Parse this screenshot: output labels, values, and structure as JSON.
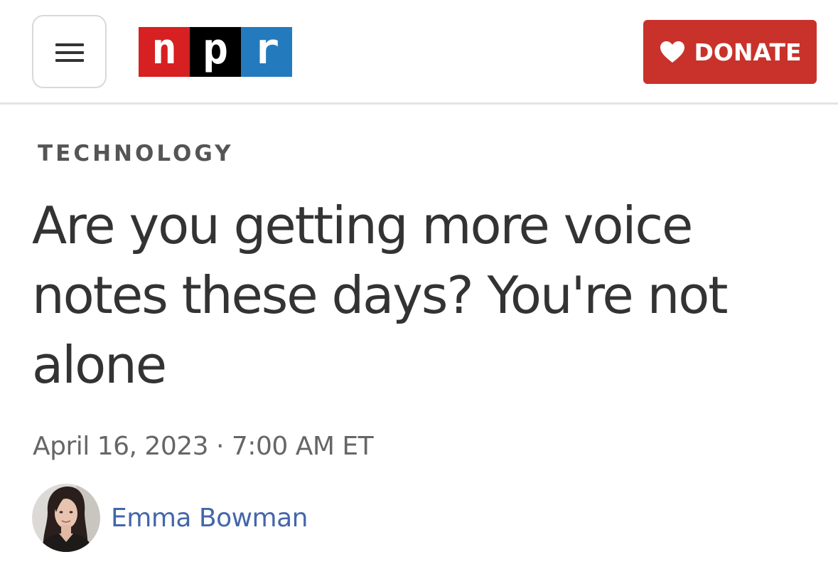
{
  "header": {
    "logo": {
      "letters": [
        "n",
        "p",
        "r"
      ]
    },
    "donate_label": "DONATE"
  },
  "article": {
    "section": "TECHNOLOGY",
    "headline": "Are you getting more voice notes these days? You're not alone",
    "date": "April 16, 2023",
    "separator": "·",
    "time": "7:00 AM ET",
    "author": "Emma Bowman"
  },
  "icons": {
    "menu": "hamburger-menu-icon",
    "donate": "heart-icon",
    "author": "author-avatar"
  },
  "colors": {
    "logo_n": "#d62021",
    "logo_p": "#000000",
    "logo_r": "#237bbd",
    "donate_bg": "#c8322a",
    "author_link": "#4466aa"
  }
}
